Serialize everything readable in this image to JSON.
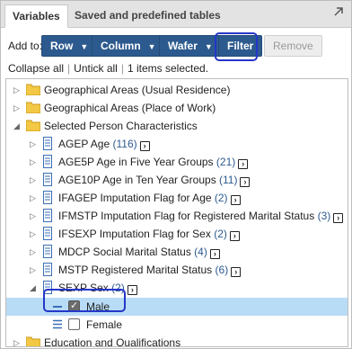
{
  "tabs": [
    {
      "label": "Variables",
      "active": true
    },
    {
      "label": "Saved and predefined tables",
      "active": false
    }
  ],
  "toolbar": {
    "add_to_label": "Add to:",
    "row_label": "Row",
    "column_label": "Column",
    "wafer_label": "Wafer",
    "filter_label": "Filter",
    "remove_label": "Remove"
  },
  "actions": {
    "collapse_all": "Collapse all",
    "untick_all": "Untick all",
    "selected_status": "1 items selected."
  },
  "tree": {
    "geo_usual": "Geographical Areas (Usual Residence)",
    "geo_work": "Geographical Areas (Place of Work)",
    "selected_person": "Selected Person Characteristics",
    "vars": [
      {
        "name": "AGEP Age",
        "count": "(116)"
      },
      {
        "name": "AGE5P Age in Five Year Groups",
        "count": "(21)"
      },
      {
        "name": "AGE10P Age in Ten Year Groups",
        "count": "(11)"
      },
      {
        "name": "IFAGEP Imputation Flag for Age",
        "count": "(2)"
      },
      {
        "name": "IFMSTP Imputation Flag for Registered Marital Status",
        "count": "(3)"
      },
      {
        "name": "IFSEXP Imputation Flag for Sex",
        "count": "(2)"
      },
      {
        "name": "MDCP Social Marital Status",
        "count": "(4)"
      },
      {
        "name": "MSTP Registered Marital Status",
        "count": "(6)"
      },
      {
        "name": "SEXP Sex",
        "count": "(2)"
      }
    ],
    "male_label": "Male",
    "female_label": "Female",
    "education": "Education and Qualifications"
  },
  "colors": {
    "button_blue": "#2d5a8e",
    "highlight_ring": "#2536c9",
    "selected_row": "#b9dcf6"
  }
}
